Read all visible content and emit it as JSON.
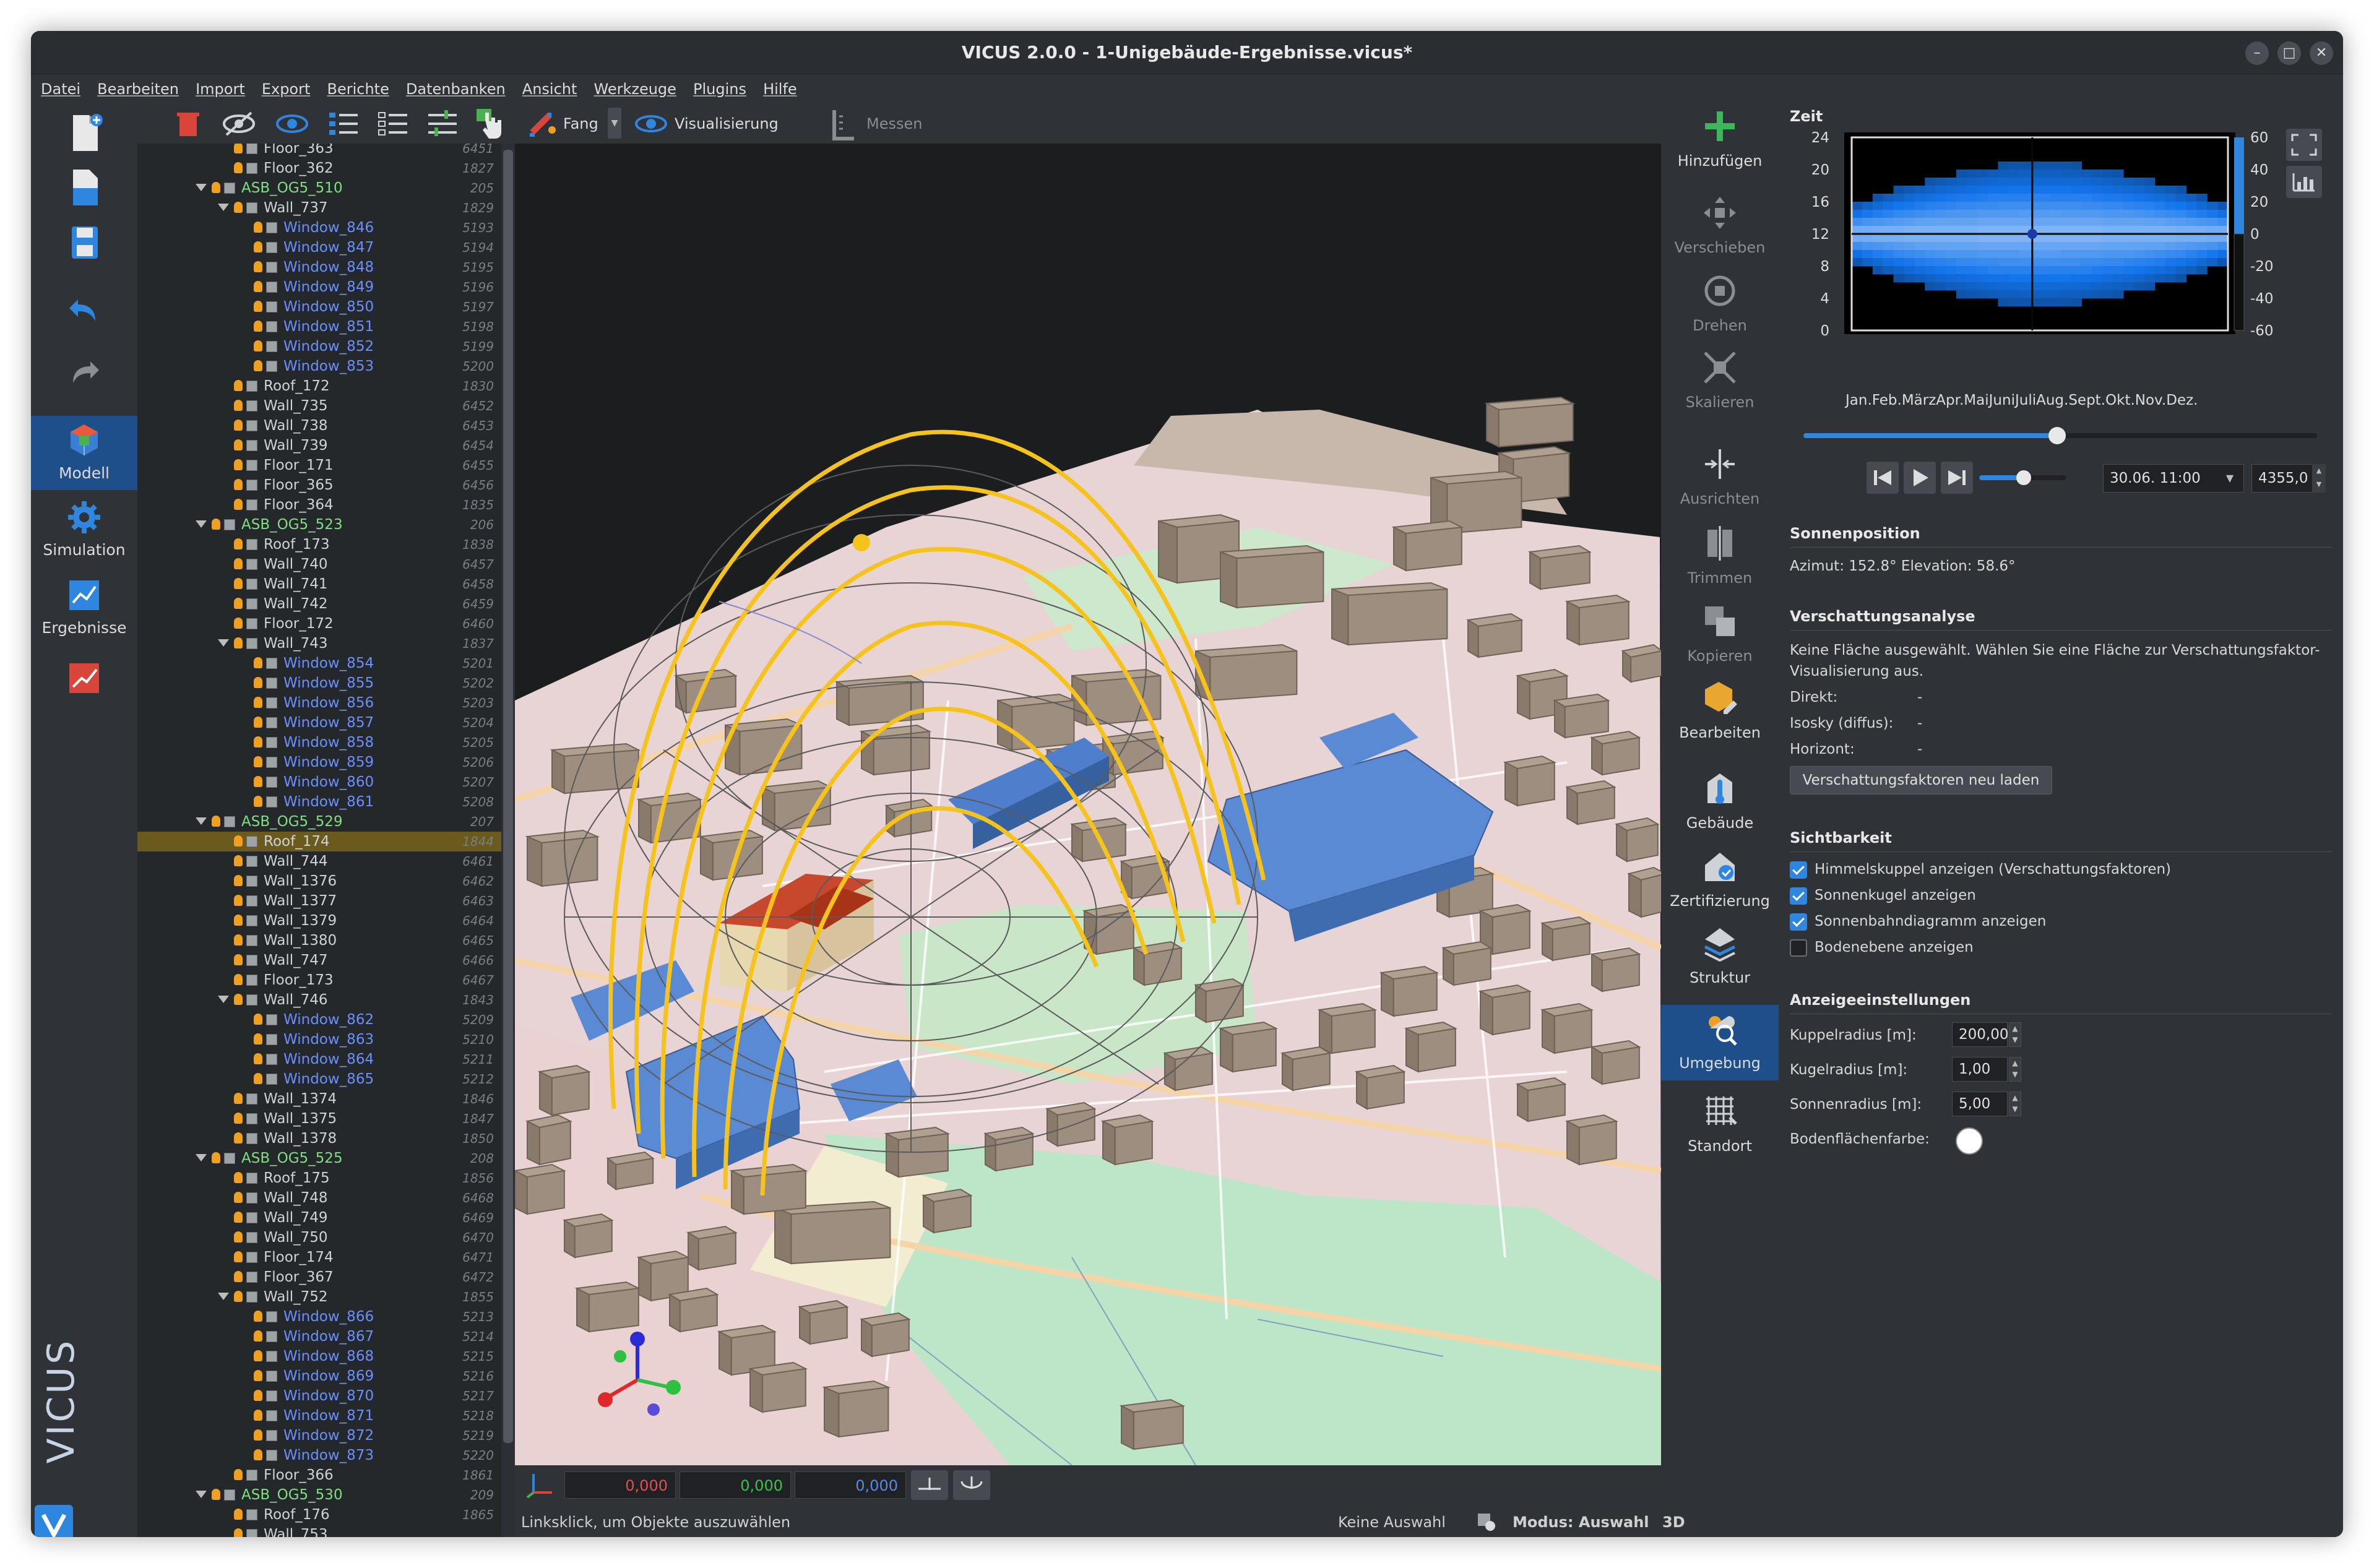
{
  "window": {
    "title": "VICUS 2.0.0 - 1-Unigebäude-Ergebnisse.vicus*"
  },
  "menu": [
    "Datei",
    "Bearbeiten",
    "Import",
    "Export",
    "Berichte",
    "Datenbanken",
    "Ansicht",
    "Werkzeuge",
    "Plugins",
    "Hilfe"
  ],
  "leftbar": {
    "modell": "Modell",
    "simulation": "Simulation",
    "ergebnisse": "Ergebnisse",
    "brand": "VICUS"
  },
  "toolbar": {
    "fang": "Fang",
    "visualisierung": "Visualisierung",
    "messen": "Messen"
  },
  "tree": [
    {
      "l": "Floor_363",
      "id": "6451",
      "d": 2,
      "c": "#cfd2d6",
      "b": 1
    },
    {
      "l": "Floor_362",
      "id": "1827",
      "d": 2,
      "c": "#cfd2d6",
      "b": 1
    },
    {
      "l": "ASB_OG5_510",
      "id": "205",
      "d": 1,
      "c": "#7ee07e",
      "b": 1,
      "e": 1
    },
    {
      "l": "Wall_737",
      "id": "1829",
      "d": 2,
      "c": "#cfd2d6",
      "b": 0,
      "e": 1
    },
    {
      "l": "Window_846",
      "id": "5193",
      "d": 3,
      "c": "#6b8fff",
      "b": 1
    },
    {
      "l": "Window_847",
      "id": "5194",
      "d": 3,
      "c": "#6b8fff",
      "b": 1
    },
    {
      "l": "Window_848",
      "id": "5195",
      "d": 3,
      "c": "#6b8fff",
      "b": 1
    },
    {
      "l": "Window_849",
      "id": "5196",
      "d": 3,
      "c": "#6b8fff",
      "b": 1
    },
    {
      "l": "Window_850",
      "id": "5197",
      "d": 3,
      "c": "#6b8fff",
      "b": 1
    },
    {
      "l": "Window_851",
      "id": "5198",
      "d": 3,
      "c": "#6b8fff",
      "b": 1
    },
    {
      "l": "Window_852",
      "id": "5199",
      "d": 3,
      "c": "#6b8fff",
      "b": 1
    },
    {
      "l": "Window_853",
      "id": "5200",
      "d": 3,
      "c": "#6b8fff",
      "b": 1
    },
    {
      "l": "Roof_172",
      "id": "1830",
      "d": 2,
      "c": "#cfd2d6",
      "b": 1
    },
    {
      "l": "Wall_735",
      "id": "6452",
      "d": 2,
      "c": "#cfd2d6",
      "b": 1
    },
    {
      "l": "Wall_738",
      "id": "6453",
      "d": 2,
      "c": "#cfd2d6",
      "b": 1
    },
    {
      "l": "Wall_739",
      "id": "6454",
      "d": 2,
      "c": "#cfd2d6",
      "b": 1
    },
    {
      "l": "Floor_171",
      "id": "6455",
      "d": 2,
      "c": "#cfd2d6",
      "b": 1
    },
    {
      "l": "Floor_365",
      "id": "6456",
      "d": 2,
      "c": "#cfd2d6",
      "b": 1
    },
    {
      "l": "Floor_364",
      "id": "1835",
      "d": 2,
      "c": "#cfd2d6",
      "b": 1
    },
    {
      "l": "ASB_OG5_523",
      "id": "206",
      "d": 1,
      "c": "#7ee07e",
      "b": 1,
      "e": 1
    },
    {
      "l": "Roof_173",
      "id": "1838",
      "d": 2,
      "c": "#cfd2d6",
      "b": 1
    },
    {
      "l": "Wall_740",
      "id": "6457",
      "d": 2,
      "c": "#cfd2d6",
      "b": 1
    },
    {
      "l": "Wall_741",
      "id": "6458",
      "d": 2,
      "c": "#cfd2d6",
      "b": 1
    },
    {
      "l": "Wall_742",
      "id": "6459",
      "d": 2,
      "c": "#cfd2d6",
      "b": 1
    },
    {
      "l": "Floor_172",
      "id": "6460",
      "d": 2,
      "c": "#cfd2d6",
      "b": 1
    },
    {
      "l": "Wall_743",
      "id": "1837",
      "d": 2,
      "c": "#cfd2d6",
      "b": 0,
      "e": 1
    },
    {
      "l": "Window_854",
      "id": "5201",
      "d": 3,
      "c": "#6b8fff",
      "b": 1
    },
    {
      "l": "Window_855",
      "id": "5202",
      "d": 3,
      "c": "#6b8fff",
      "b": 1
    },
    {
      "l": "Window_856",
      "id": "5203",
      "d": 3,
      "c": "#6b8fff",
      "b": 1
    },
    {
      "l": "Window_857",
      "id": "5204",
      "d": 3,
      "c": "#6b8fff",
      "b": 1
    },
    {
      "l": "Window_858",
      "id": "5205",
      "d": 3,
      "c": "#6b8fff",
      "b": 1
    },
    {
      "l": "Window_859",
      "id": "5206",
      "d": 3,
      "c": "#6b8fff",
      "b": 1
    },
    {
      "l": "Window_860",
      "id": "5207",
      "d": 3,
      "c": "#6b8fff",
      "b": 1
    },
    {
      "l": "Window_861",
      "id": "5208",
      "d": 3,
      "c": "#6b8fff",
      "b": 1
    },
    {
      "l": "ASB_OG5_529",
      "id": "207",
      "d": 1,
      "c": "#7ee07e",
      "b": 1,
      "e": 1
    },
    {
      "l": "Roof_174",
      "id": "1844",
      "d": 2,
      "c": "#cfd2d6",
      "b": 1,
      "s": 1
    },
    {
      "l": "Wall_744",
      "id": "6461",
      "d": 2,
      "c": "#cfd2d6",
      "b": 1
    },
    {
      "l": "Wall_1376",
      "id": "6462",
      "d": 2,
      "c": "#cfd2d6",
      "b": 1
    },
    {
      "l": "Wall_1377",
      "id": "6463",
      "d": 2,
      "c": "#cfd2d6",
      "b": 1
    },
    {
      "l": "Wall_1379",
      "id": "6464",
      "d": 2,
      "c": "#cfd2d6",
      "b": 1
    },
    {
      "l": "Wall_1380",
      "id": "6465",
      "d": 2,
      "c": "#cfd2d6",
      "b": 1
    },
    {
      "l": "Wall_747",
      "id": "6466",
      "d": 2,
      "c": "#cfd2d6",
      "b": 1
    },
    {
      "l": "Floor_173",
      "id": "6467",
      "d": 2,
      "c": "#cfd2d6",
      "b": 1
    },
    {
      "l": "Wall_746",
      "id": "1843",
      "d": 2,
      "c": "#cfd2d6",
      "b": 0,
      "e": 1
    },
    {
      "l": "Window_862",
      "id": "5209",
      "d": 3,
      "c": "#6b8fff",
      "b": 1
    },
    {
      "l": "Window_863",
      "id": "5210",
      "d": 3,
      "c": "#6b8fff",
      "b": 1
    },
    {
      "l": "Window_864",
      "id": "5211",
      "d": 3,
      "c": "#6b8fff",
      "b": 1
    },
    {
      "l": "Window_865",
      "id": "5212",
      "d": 3,
      "c": "#6b8fff",
      "b": 1
    },
    {
      "l": "Wall_1374",
      "id": "1846",
      "d": 2,
      "c": "#cfd2d6",
      "b": 1
    },
    {
      "l": "Wall_1375",
      "id": "1847",
      "d": 2,
      "c": "#cfd2d6",
      "b": 1
    },
    {
      "l": "Wall_1378",
      "id": "1850",
      "d": 2,
      "c": "#cfd2d6",
      "b": 1
    },
    {
      "l": "ASB_OG5_525",
      "id": "208",
      "d": 1,
      "c": "#7ee07e",
      "b": 1,
      "e": 1
    },
    {
      "l": "Roof_175",
      "id": "1856",
      "d": 2,
      "c": "#cfd2d6",
      "b": 1
    },
    {
      "l": "Wall_748",
      "id": "6468",
      "d": 2,
      "c": "#cfd2d6",
      "b": 1
    },
    {
      "l": "Wall_749",
      "id": "6469",
      "d": 2,
      "c": "#cfd2d6",
      "b": 1
    },
    {
      "l": "Wall_750",
      "id": "6470",
      "d": 2,
      "c": "#cfd2d6",
      "b": 1
    },
    {
      "l": "Floor_174",
      "id": "6471",
      "d": 2,
      "c": "#cfd2d6",
      "b": 1
    },
    {
      "l": "Floor_367",
      "id": "6472",
      "d": 2,
      "c": "#cfd2d6",
      "b": 1
    },
    {
      "l": "Wall_752",
      "id": "1855",
      "d": 2,
      "c": "#cfd2d6",
      "b": 0,
      "e": 1
    },
    {
      "l": "Window_866",
      "id": "5213",
      "d": 3,
      "c": "#6b8fff",
      "b": 1
    },
    {
      "l": "Window_867",
      "id": "5214",
      "d": 3,
      "c": "#6b8fff",
      "b": 1
    },
    {
      "l": "Window_868",
      "id": "5215",
      "d": 3,
      "c": "#6b8fff",
      "b": 1
    },
    {
      "l": "Window_869",
      "id": "5216",
      "d": 3,
      "c": "#6b8fff",
      "b": 1
    },
    {
      "l": "Window_870",
      "id": "5217",
      "d": 3,
      "c": "#6b8fff",
      "b": 1
    },
    {
      "l": "Window_871",
      "id": "5218",
      "d": 3,
      "c": "#6b8fff",
      "b": 1
    },
    {
      "l": "Window_872",
      "id": "5219",
      "d": 3,
      "c": "#6b8fff",
      "b": 1
    },
    {
      "l": "Window_873",
      "id": "5220",
      "d": 3,
      "c": "#6b8fff",
      "b": 1
    },
    {
      "l": "Floor_366",
      "id": "1861",
      "d": 2,
      "c": "#cfd2d6",
      "b": 1
    },
    {
      "l": "ASB_OG5_530",
      "id": "209",
      "d": 1,
      "c": "#7ee07e",
      "b": 1,
      "e": 1
    },
    {
      "l": "Roof_176",
      "id": "1865",
      "d": 2,
      "c": "#cfd2d6",
      "b": 1
    },
    {
      "l": "Wall_753",
      "id": "",
      "d": 2,
      "c": "#cfd2d6",
      "b": 1
    }
  ],
  "coords": {
    "x": "0,000",
    "y": "0,000",
    "z": "0,000"
  },
  "status": {
    "hint": "Linksklick, um Objekte auszuwählen",
    "selection": "Keine Auswahl",
    "mode": "Modus: Auswahl",
    "view": "3D"
  },
  "righttools": {
    "add": "Hinzufügen",
    "move": "Verschieben",
    "rotate": "Drehen",
    "scale": "Skalieren",
    "align": "Ausrichten",
    "trim": "Trimmen",
    "copy": "Kopieren",
    "edit": "Bearbeiten",
    "building": "Gebäude",
    "cert": "Zertifizierung",
    "structure": "Struktur",
    "env": "Umgebung",
    "location": "Standort"
  },
  "panel": {
    "zeit": "Zeit",
    "yticks": [
      "24",
      "20",
      "16",
      "12",
      "8",
      "4",
      "0"
    ],
    "cticks": [
      "60",
      "40",
      "20",
      "0",
      "-20",
      "-40",
      "-60"
    ],
    "months": [
      "Jan.",
      "Feb.",
      "März",
      "Apr.",
      "Mai",
      "Juni",
      "Juli",
      "Aug.",
      "Sept.",
      "Okt.",
      "Nov.",
      "Dez."
    ],
    "date": "30.06.  11:00",
    "hours": "4355,0 h",
    "sonne_h": "Sonnenposition",
    "sonne": "Azimut:  152.8°  Elevation:  58.6°",
    "vs_h": "Verschattungsanalyse",
    "vs_text1": "Keine Fläche ausgewählt. Wählen Sie eine Fläche zur Verschattungsfaktor-",
    "vs_text2": "Visualisierung aus.",
    "direkt": "Direkt:",
    "direkt_v": "-",
    "isosky": "Isosky (diffus):",
    "isosky_v": "-",
    "horizont": "Horizont:",
    "horizont_v": "-",
    "reload": "Verschattungsfaktoren neu laden",
    "sicht_h": "Sichtbarkeit",
    "c1": "Himmelskuppel anzeigen (Verschattungsfaktoren)",
    "c2": "Sonnenkugel anzeigen",
    "c3": "Sonnenbahndiagramm anzeigen",
    "c4": "Bodenebene anzeigen",
    "anz_h": "Anzeigeeinstellungen",
    "kuppel": "Kuppelradius [m]:",
    "kuppel_v": "200,00",
    "kugel": "Kugelradius [m]:",
    "kugel_v": "1,00",
    "sonnenr": "Sonnenradius [m]:",
    "sonnenr_v": "5,00",
    "boden": "Bodenflächenfarbe:"
  }
}
